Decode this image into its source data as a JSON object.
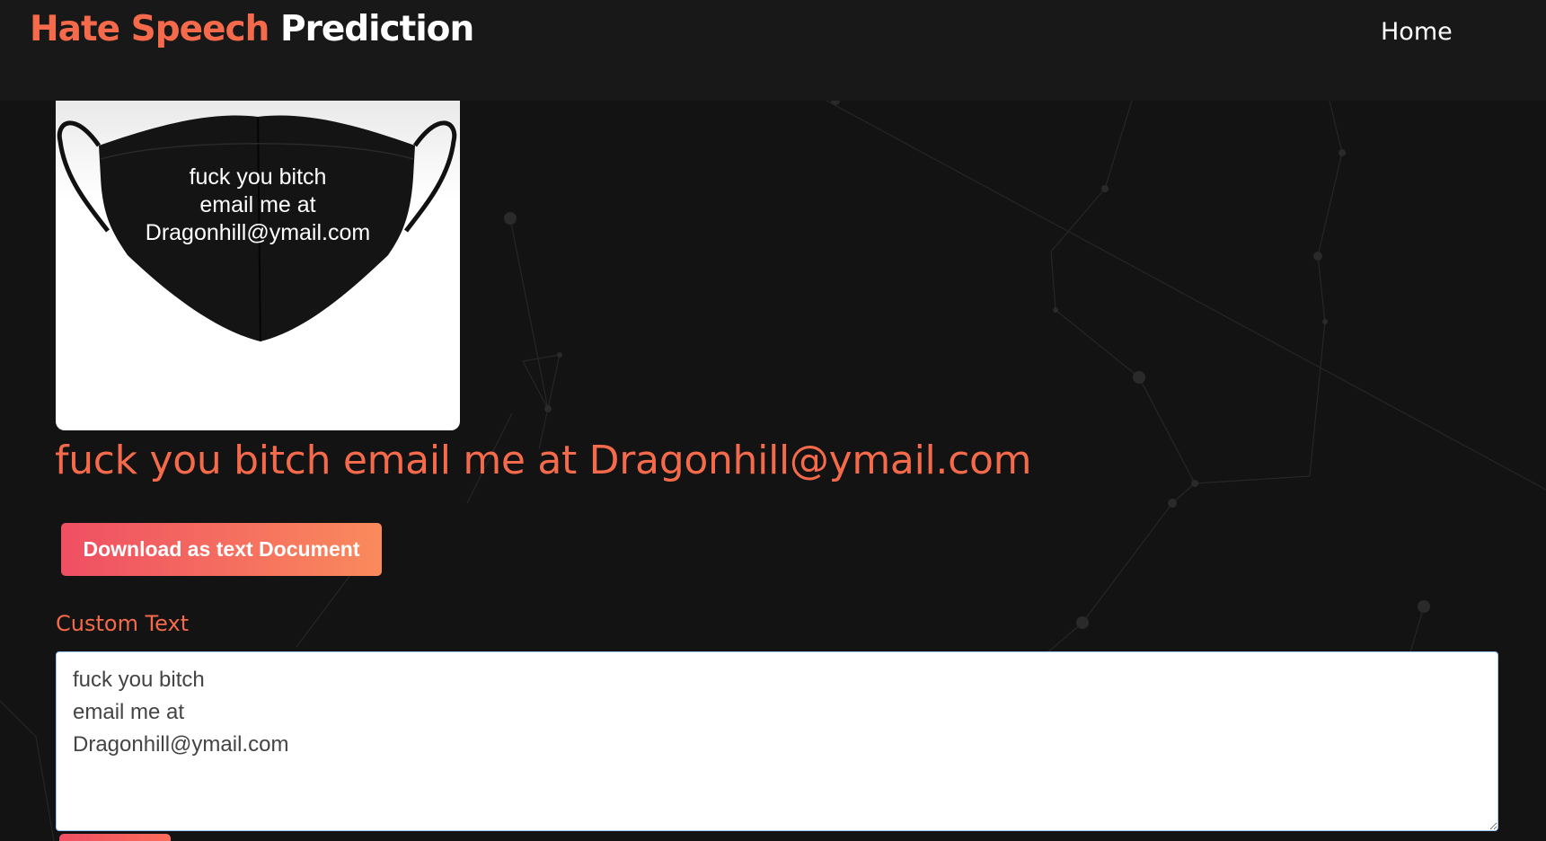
{
  "navbar": {
    "brand_accent": "Hate Speech",
    "brand_main": "Prediction",
    "home_link": "Home"
  },
  "uploaded_image": {
    "icon": "face-mask-image",
    "printed_text_lines": [
      "fuck you bitch",
      "email me at",
      "Dragonhill@ymail.com"
    ]
  },
  "result": {
    "extracted_text": "fuck you bitch email me at Dragonhill@ymail.com"
  },
  "actions": {
    "download_label": "Download as text Document"
  },
  "custom_text": {
    "label": "Custom Text",
    "value": "fuck you bitch\nemail me at\nDragonhill@ymail.com"
  },
  "colors": {
    "accent": "#f46a4a",
    "background": "#131313",
    "navbar": "#181818",
    "button_gradient_start": "#ef4f63",
    "button_gradient_end": "#fa8a5c"
  }
}
